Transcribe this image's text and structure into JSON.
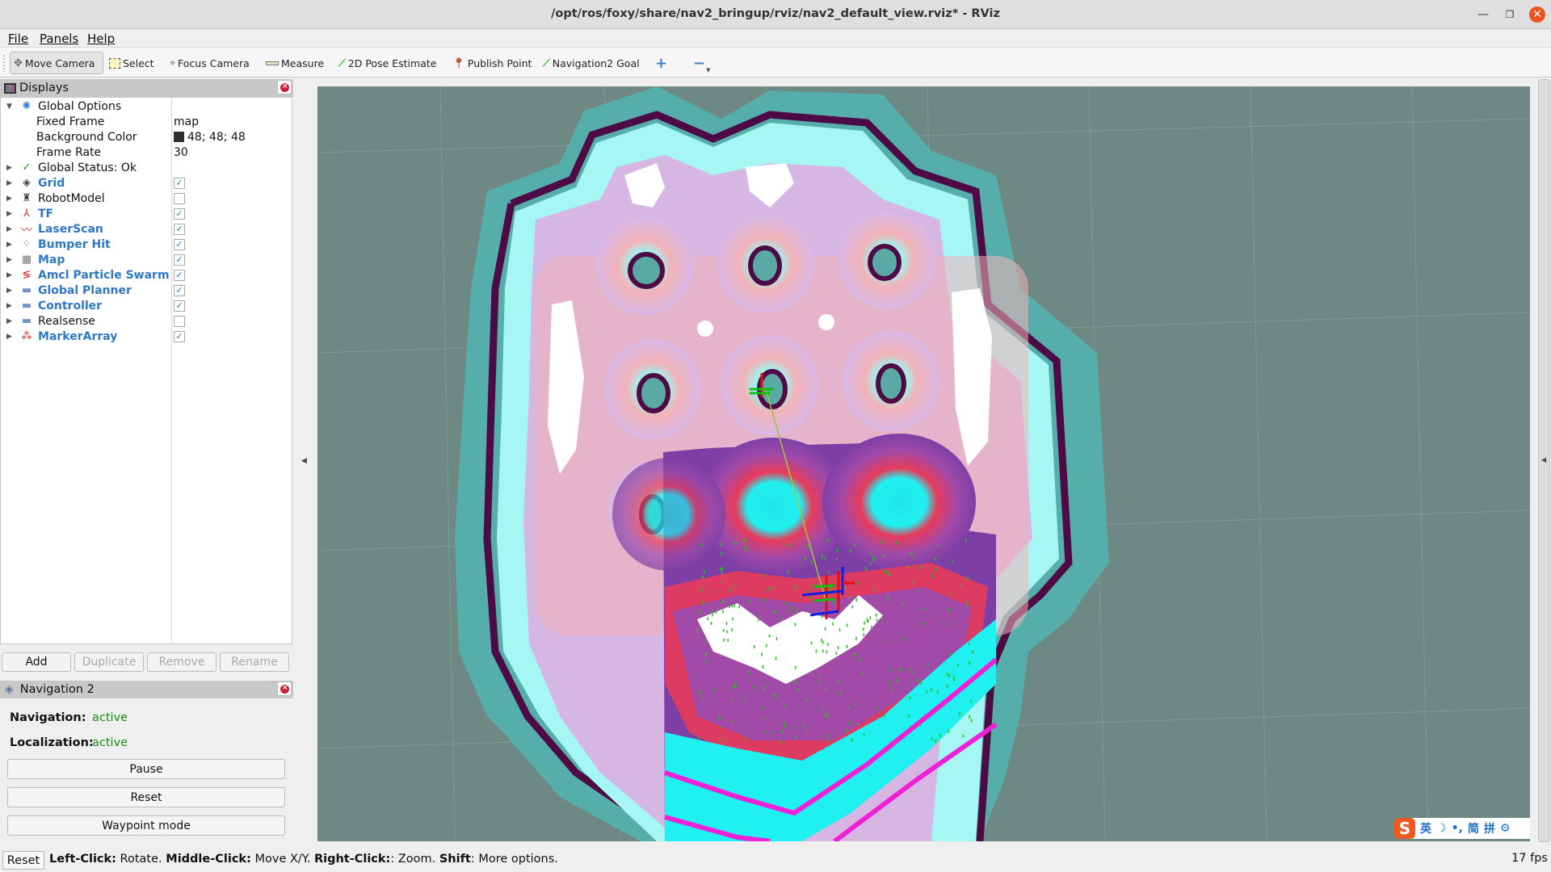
{
  "window": {
    "title": "/opt/ros/foxy/share/nav2_bringup/rviz/nav2_default_view.rviz* - RViz",
    "minimize_icon": "minimize-icon",
    "maximize_icon": "restore-icon",
    "close_icon": "close-icon"
  },
  "menu": [
    "File",
    "Panels",
    "Help"
  ],
  "toolbar": {
    "tools": [
      {
        "label": "Move Camera",
        "icon": "move-camera-icon",
        "active": true
      },
      {
        "label": "Select",
        "icon": "select-icon",
        "active": false
      },
      {
        "label": "Focus Camera",
        "icon": "focus-camera-icon",
        "active": false
      },
      {
        "label": "Measure",
        "icon": "ruler-icon",
        "active": false
      },
      {
        "label": "2D Pose Estimate",
        "icon": "green-arrow-icon",
        "active": false
      },
      {
        "label": "Publish Point",
        "icon": "map-pin-icon",
        "active": false
      },
      {
        "label": "Navigation2 Goal",
        "icon": "green-arrow-icon",
        "active": false
      }
    ],
    "add_tool": "+",
    "remove_tool": "−"
  },
  "displays_panel": {
    "title": "Displays",
    "global_options": {
      "label": "Global Options",
      "fixed_frame_label": "Fixed Frame",
      "fixed_frame_value": "map",
      "background_color_label": "Background Color",
      "background_color_value": "48; 48; 48",
      "background_color_hex": "#303030",
      "frame_rate_label": "Frame Rate",
      "frame_rate_value": "30"
    },
    "global_status": "Global Status: Ok",
    "items": [
      {
        "label": "Grid",
        "icon": "grid-icon",
        "checked": true,
        "enabled": true
      },
      {
        "label": "RobotModel",
        "icon": "robot-model-icon",
        "checked": false,
        "enabled": false
      },
      {
        "label": "TF",
        "icon": "tf-axes-icon",
        "checked": true,
        "enabled": true
      },
      {
        "label": "LaserScan",
        "icon": "laser-scan-icon",
        "checked": true,
        "enabled": true
      },
      {
        "label": "Bumper Hit",
        "icon": "bumper-hit-icon",
        "checked": true,
        "enabled": true
      },
      {
        "label": "Map",
        "icon": "map-icon",
        "checked": true,
        "enabled": true
      },
      {
        "label": "Amcl Particle Swarm",
        "icon": "particle-swarm-icon",
        "checked": true,
        "enabled": true
      },
      {
        "label": "Global Planner",
        "icon": "folder-icon",
        "checked": true,
        "enabled": true
      },
      {
        "label": "Controller",
        "icon": "folder-icon",
        "checked": true,
        "enabled": true
      },
      {
        "label": "Realsense",
        "icon": "folder-icon",
        "checked": false,
        "enabled": false
      },
      {
        "label": "MarkerArray",
        "icon": "marker-array-icon",
        "checked": true,
        "enabled": true
      }
    ],
    "buttons": [
      {
        "label": "Add",
        "disabled": false
      },
      {
        "label": "Duplicate",
        "disabled": true
      },
      {
        "label": "Remove",
        "disabled": true
      },
      {
        "label": "Rename",
        "disabled": true
      }
    ]
  },
  "nav2_panel": {
    "title": "Navigation 2",
    "navigation_label": "Navigation:",
    "navigation_value": "active",
    "localization_label": "Localization:",
    "localization_value": "active",
    "pause_label": "Pause",
    "reset_label": "Reset",
    "waypoint_label": "Waypoint mode",
    "status_color": "#188a18"
  },
  "viewport": {
    "background_color": "#6e8883",
    "grid_color": "#8ea19d"
  },
  "ime": {
    "logo": "S",
    "items": [
      "英",
      "☽",
      "•,",
      "简",
      "拼",
      "⚙"
    ]
  },
  "statusbar": {
    "reset_label": "Reset",
    "hint": [
      {
        "bold": "Left-Click:",
        "text": " Rotate. "
      },
      {
        "bold": "Middle-Click:",
        "text": " Move X/Y. "
      },
      {
        "bold": "Right-Click:",
        "text": ": Zoom. "
      },
      {
        "bold": "Shift",
        "text": ": More options."
      }
    ],
    "fps": "17 fps"
  }
}
